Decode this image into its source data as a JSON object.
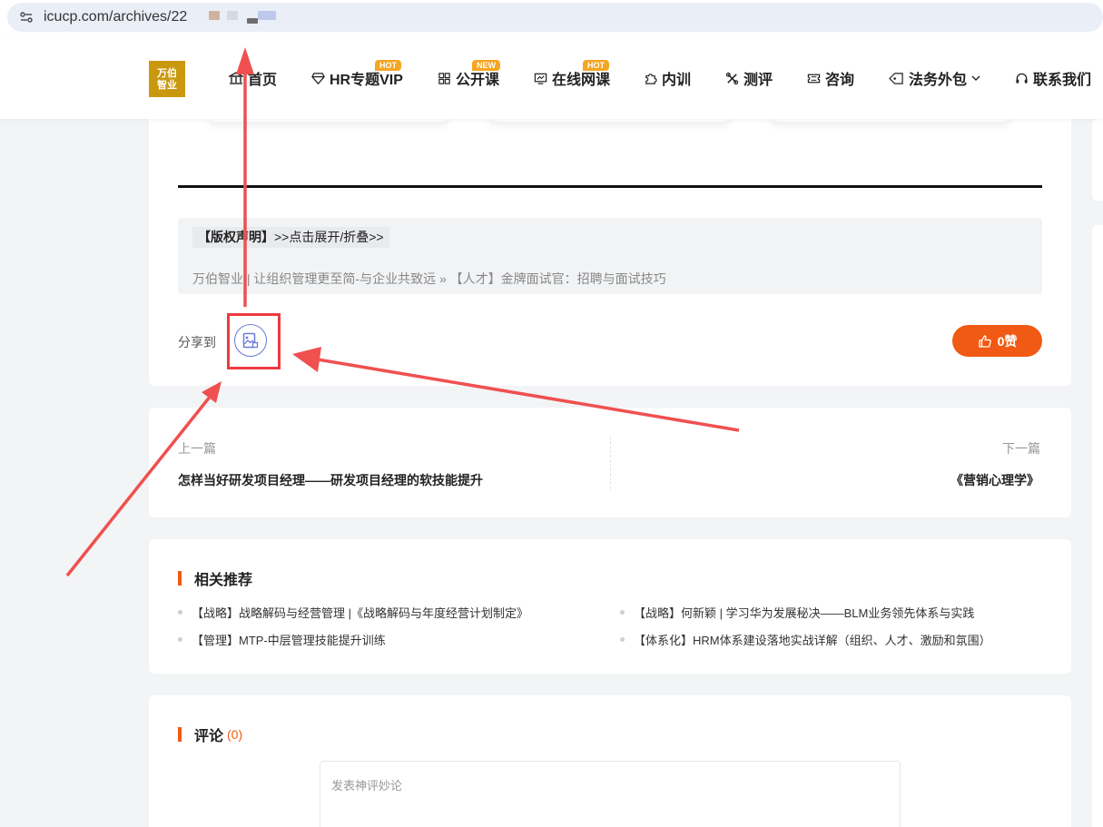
{
  "browser": {
    "url": "icucp.com/archives/22",
    "colors": {
      "blur1": "#d2b29e",
      "blur2": "#d6d9de",
      "blur3": "#bcc9ec",
      "blur4": "#6e6e6e"
    }
  },
  "header": {
    "logo_line1": "万伯",
    "logo_line2": "智业",
    "nav": [
      {
        "label": "首页",
        "icon": "bank-icon"
      },
      {
        "label": "HR专题VIP",
        "icon": "diamond-icon",
        "badge": "HOT"
      },
      {
        "label": "公开课",
        "icon": "grid-icon",
        "badge": "NEW"
      },
      {
        "label": "在线网课",
        "icon": "monitor-icon",
        "badge": "HOT"
      },
      {
        "label": "内训",
        "icon": "puzzle-icon"
      },
      {
        "label": "测评",
        "icon": "tools-icon"
      },
      {
        "label": "咨询",
        "icon": "ticket-icon"
      },
      {
        "label": "法务外包",
        "icon": "tag-icon",
        "has_dropdown": true
      },
      {
        "label": "联系我们",
        "icon": "headset-icon"
      }
    ]
  },
  "article": {
    "copyright_toggle_bold": "【版权声明】",
    "copyright_toggle_rest": ">>点击展开/折叠>>",
    "breadcrumb": "万伯智业 | 让组织管理更至简-与企业共致远 » 【人才】金牌面试官：招聘与面试技巧",
    "share_label": "分享到",
    "like_label": "0赞"
  },
  "post_nav": {
    "prev_label": "上一篇",
    "prev_title": "怎样当好研发项目经理——研发项目经理的软技能提升",
    "next_label": "下一篇",
    "next_title": "《营销心理学》"
  },
  "related": {
    "title": "相关推荐",
    "items": [
      "【战略】战略解码与经营管理 |《战略解码与年度经营计划制定》",
      "【战略】何新颖 | 学习华为发展秘决——BLM业务领先体系与实践",
      "【管理】MTP-中层管理技能提升训练",
      "【体系化】HRM体系建设落地实战详解（组织、人才、激励和氛围）"
    ]
  },
  "comments": {
    "title": "评论",
    "count": "(0)",
    "placeholder": "发表神评妙论"
  },
  "colors": {
    "accent": "#f05a14",
    "logo": "#c9980f",
    "badge": "#f5a623",
    "annotation": "#ec3b41",
    "share_icon": "#6a7bd8"
  }
}
